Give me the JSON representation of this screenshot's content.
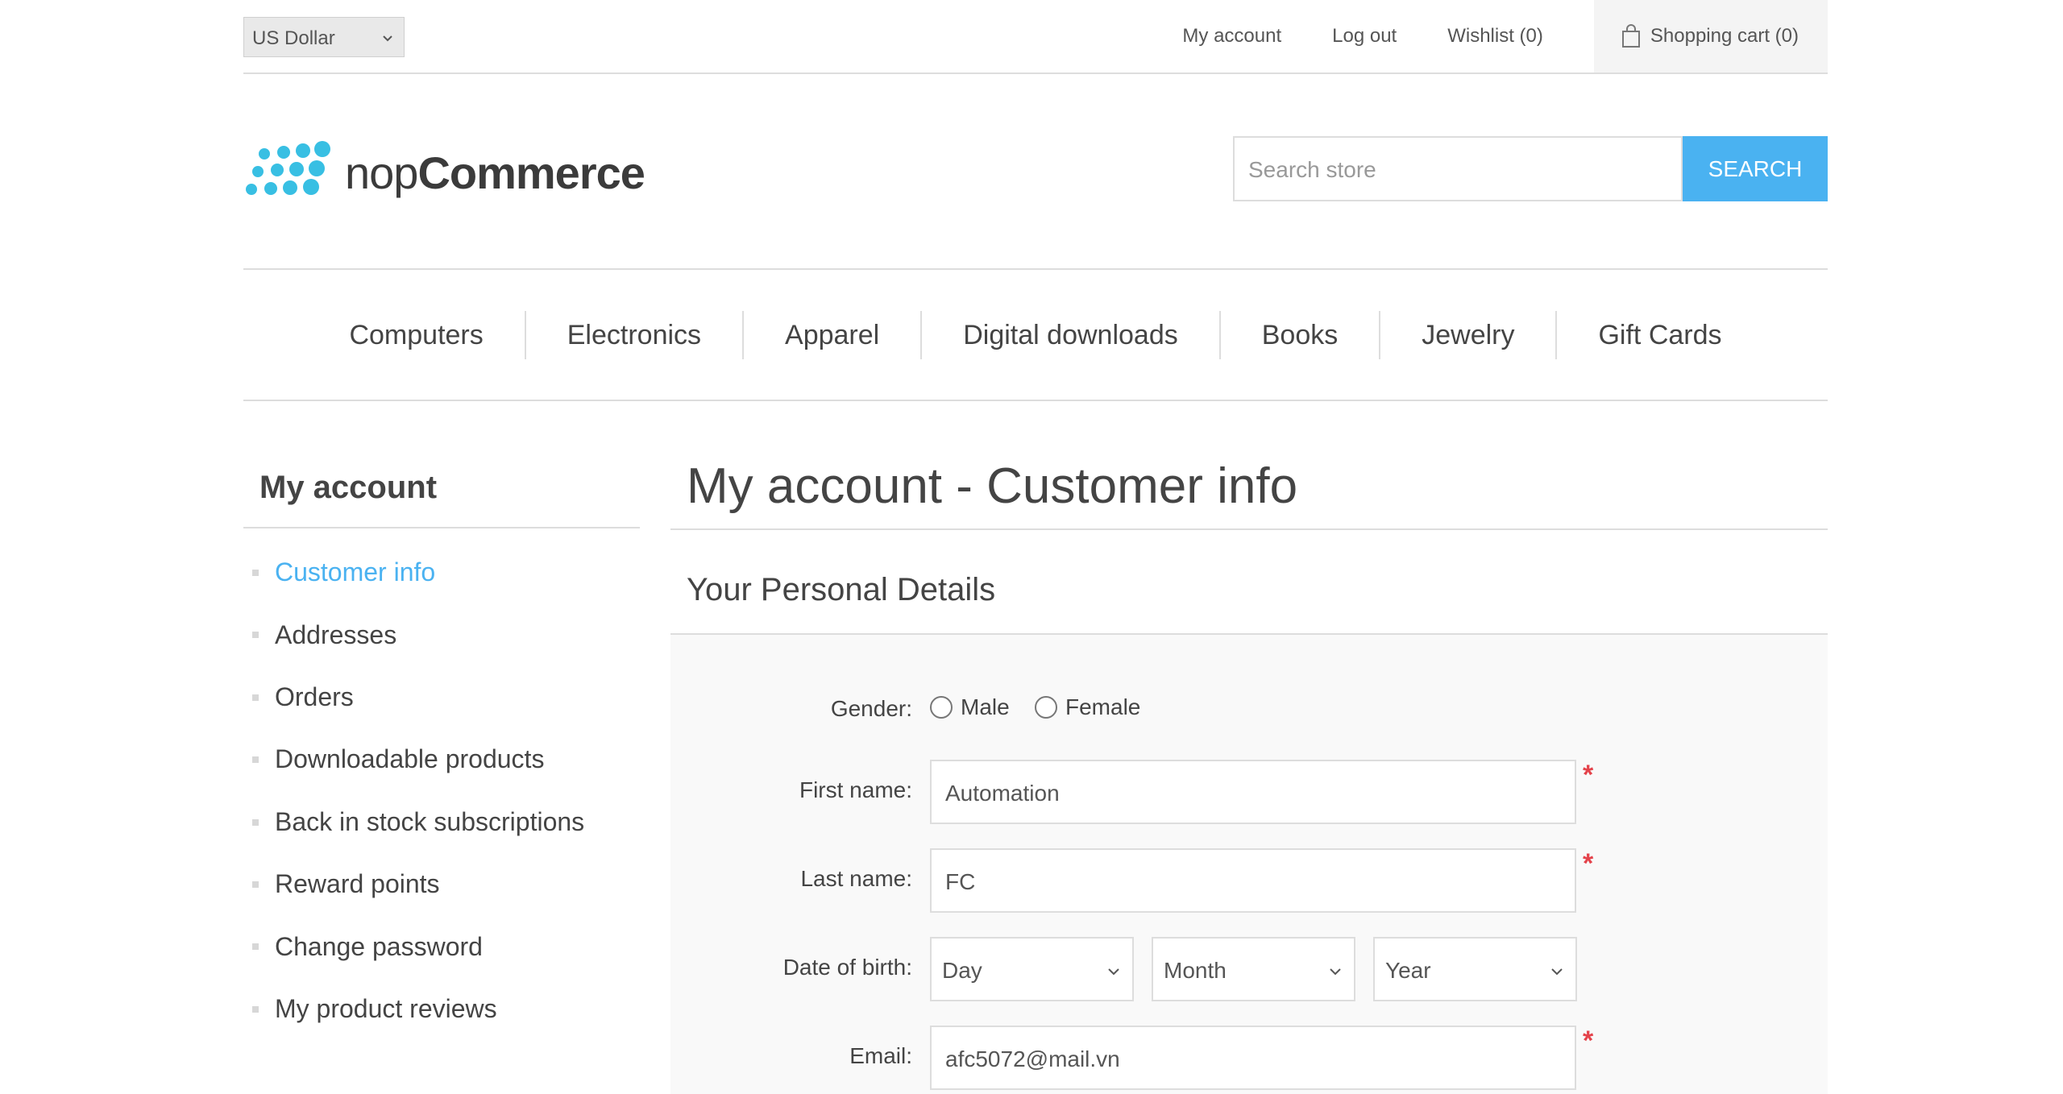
{
  "header": {
    "currency": "US Dollar",
    "links": {
      "my_account": "My account",
      "log_out": "Log out",
      "wishlist": "Wishlist (0)",
      "shopping_cart": "Shopping cart (0)"
    }
  },
  "logo": {
    "light": "nop",
    "bold": "Commerce",
    "dot_color": "#38bfe3"
  },
  "search": {
    "placeholder": "Search store",
    "button": "Search"
  },
  "menu": [
    "Computers",
    "Electronics",
    "Apparel",
    "Digital downloads",
    "Books",
    "Jewelry",
    "Gift Cards"
  ],
  "sidebar": {
    "title": "My account",
    "items": [
      "Customer info",
      "Addresses",
      "Orders",
      "Downloadable products",
      "Back in stock subscriptions",
      "Reward points",
      "Change password",
      "My product reviews"
    ],
    "active_index": 0
  },
  "page": {
    "title": "My account - Customer info",
    "section_title": "Your Personal Details"
  },
  "form": {
    "gender_label": "Gender:",
    "gender_options": [
      "Male",
      "Female"
    ],
    "first_name_label": "First name:",
    "first_name_value": "Automation",
    "last_name_label": "Last name:",
    "last_name_value": "FC",
    "dob_label": "Date of birth:",
    "dob_day": "Day",
    "dob_month": "Month",
    "dob_year": "Year",
    "email_label": "Email:",
    "email_value": "afc5072@mail.vn",
    "required_mark": "*"
  },
  "colors": {
    "accent": "#4ab2f1",
    "required": "#e4434b"
  }
}
